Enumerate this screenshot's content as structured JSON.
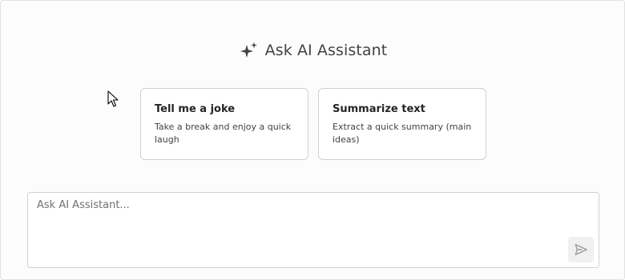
{
  "header": {
    "title": "Ask AI Assistant",
    "icon": "sparkle-icon"
  },
  "suggestions": [
    {
      "title": "Tell me a joke",
      "description": "Take a break and enjoy a quick laugh"
    },
    {
      "title": "Summarize text",
      "description": "Extract a quick summary (main ideas)"
    }
  ],
  "composer": {
    "placeholder": "Ask AI Assistant...",
    "value": "",
    "send_icon": "send-icon"
  },
  "colors": {
    "border": "#d1d1d1",
    "icon": "#424242",
    "send_icon": "#9e9e9e"
  }
}
